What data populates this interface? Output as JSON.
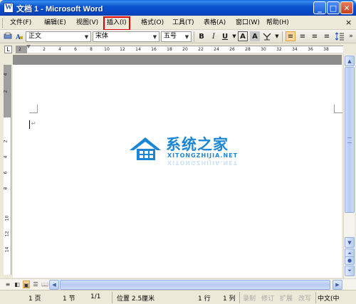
{
  "window": {
    "title": "文档 1 - Microsoft Word",
    "minimize_glyph": "_",
    "maximize_glyph": "□",
    "close_glyph": "✕"
  },
  "menubar": {
    "items": [
      {
        "label": "文件(F)"
      },
      {
        "label": "编辑(E)"
      },
      {
        "label": "视图(V)"
      },
      {
        "label": "插入(I)",
        "highlighted": true
      },
      {
        "label": "格式(O)"
      },
      {
        "label": "工具(T)"
      },
      {
        "label": "表格(A)"
      },
      {
        "label": "窗口(W)"
      },
      {
        "label": "帮助(H)"
      }
    ],
    "close_doc_glyph": "×"
  },
  "toolbar": {
    "style_value": "正文",
    "font_value": "宋体",
    "size_value": "五号",
    "bold_label": "B",
    "italic_label": "I",
    "underline_label": "U",
    "font_color_label": "A",
    "char_shading_label": "A",
    "align_left_label": "≡",
    "center_label": "≡",
    "align_right_label": "≡",
    "justify_label": "≡",
    "more_label": "»"
  },
  "ruler": {
    "corner_label": "L",
    "h_ticks": [
      "2",
      "2",
      "4",
      "6",
      "8",
      "10",
      "12",
      "14",
      "16",
      "18",
      "20",
      "22",
      "24",
      "26",
      "28",
      "30",
      "32",
      "34",
      "36",
      "38"
    ],
    "v_ticks": [
      "4",
      "2",
      "2",
      "4",
      "6",
      "8",
      "10",
      "12",
      "14"
    ]
  },
  "document": {
    "paragraph_mark": "↵",
    "watermark": {
      "main": "系统之家",
      "sub": "XITONGZHIJIA.NET"
    }
  },
  "statusbar": {
    "page": "1 页",
    "section": "1 节",
    "page_of": "1/1",
    "position": "位置 2.5厘米",
    "line": "1 行",
    "column": "1 列",
    "rec": "录制",
    "trk": "修订",
    "ext": "扩展",
    "ovr": "改写",
    "language": "中文(中"
  },
  "colors": {
    "title_bar": "#0a55d0",
    "highlight_box": "#e00000",
    "watermark": "#1a86d6"
  }
}
